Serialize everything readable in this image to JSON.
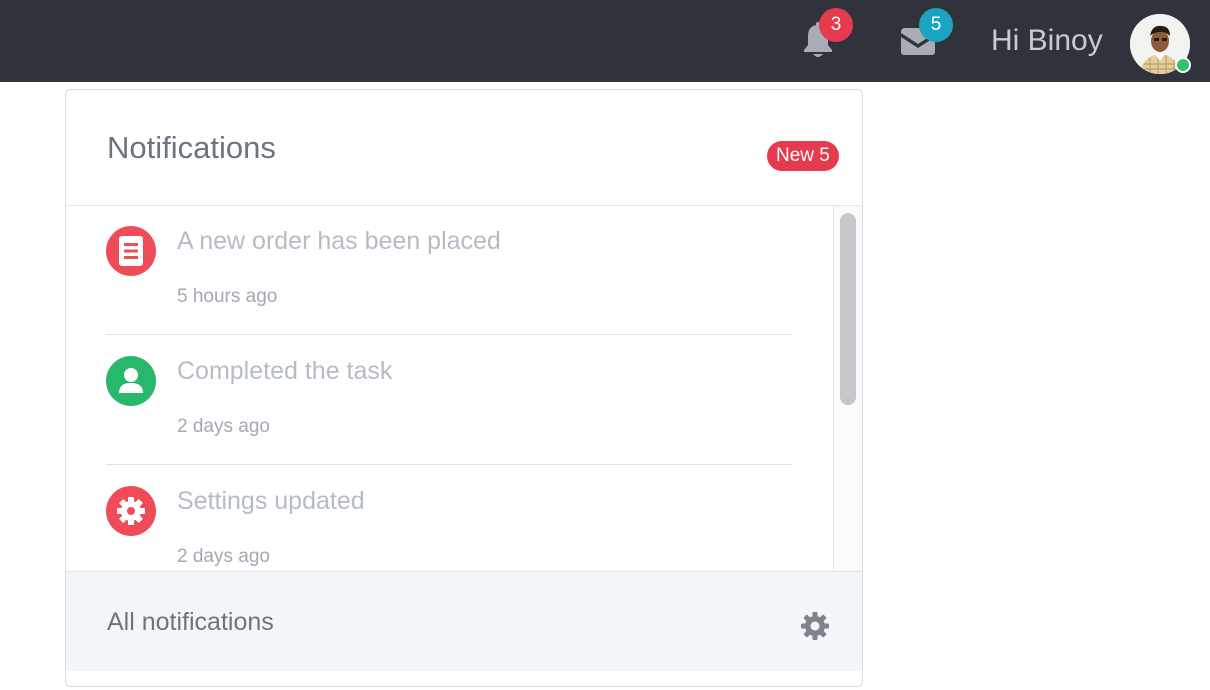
{
  "topbar": {
    "notifications_count": "3",
    "messages_count": "5",
    "greeting": "Hi Binoy",
    "icons": {
      "notifications": "bell-icon",
      "messages": "envelope-icon",
      "avatar": "user-avatar",
      "online": "online-status-dot"
    },
    "colors": {
      "background": "#30333c",
      "notifications_badge": "#e63a4f",
      "messages_badge": "#1aa4c2",
      "online": "#2fc46a"
    }
  },
  "panel": {
    "title": "Notifications",
    "new_badge": "New 5",
    "items": [
      {
        "title": "A new order has been placed",
        "time": "5 hours ago",
        "icon": "document-icon",
        "icon_color": "#f04b58"
      },
      {
        "title": "Completed the task",
        "time": "2 days ago",
        "icon": "user-icon",
        "icon_color": "#27b86c"
      },
      {
        "title": "Settings updated",
        "time": "2 days ago",
        "icon": "gear-icon",
        "icon_color": "#f04b58"
      }
    ],
    "footer": {
      "link": "All notifications",
      "settings_icon": "gear-icon"
    }
  }
}
